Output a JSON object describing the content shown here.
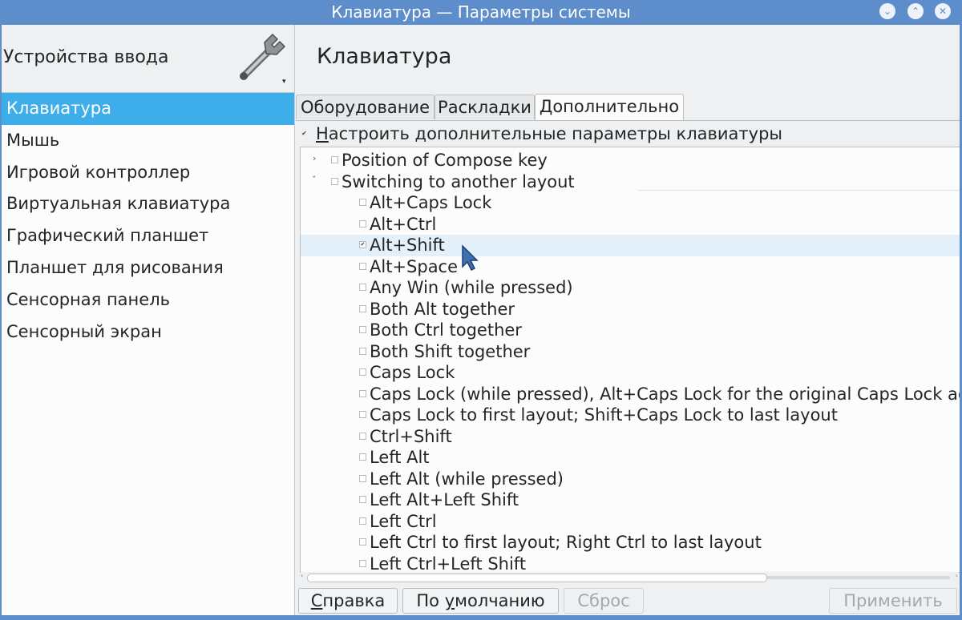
{
  "window": {
    "title": "Клавиатура — Параметры системы",
    "buttons": [
      {
        "name": "minimize",
        "glyph": "⌄"
      },
      {
        "name": "maximize",
        "glyph": "⌃"
      },
      {
        "name": "close",
        "glyph": "✕"
      }
    ]
  },
  "sidebar": {
    "header": "Устройства ввода",
    "icon": "wrench-icon",
    "items": [
      {
        "label": "Клавиатура",
        "selected": true
      },
      {
        "label": "Мышь",
        "selected": false
      },
      {
        "label": "Игровой контроллер",
        "selected": false
      },
      {
        "label": "Виртуальная клавиатура",
        "selected": false
      },
      {
        "label": "Графический планшет",
        "selected": false
      },
      {
        "label": "Планшет для рисования",
        "selected": false
      },
      {
        "label": "Сенсорная панель",
        "selected": false
      },
      {
        "label": "Сенсорный экран",
        "selected": false
      }
    ]
  },
  "main": {
    "title": "Клавиатура",
    "tabs": [
      {
        "label": "Оборудование",
        "active": false
      },
      {
        "label": "Раскладки",
        "active": false
      },
      {
        "label": "Дополнительно",
        "active": true
      }
    ],
    "configure_option": {
      "label": "Настроить дополнительные параметры клавиатуры",
      "checked": true
    },
    "tree": {
      "groups": [
        {
          "label": "Position of Compose key",
          "expanded": false
        },
        {
          "label": "Switching to another layout",
          "expanded": true
        }
      ],
      "options": [
        {
          "label": "Alt+Caps Lock",
          "checked": false
        },
        {
          "label": "Alt+Ctrl",
          "checked": false
        },
        {
          "label": "Alt+Shift",
          "checked": true,
          "highlighted": true
        },
        {
          "label": "Alt+Space",
          "checked": false
        },
        {
          "label": "Any Win (while pressed)",
          "checked": false
        },
        {
          "label": "Both Alt together",
          "checked": false
        },
        {
          "label": "Both Ctrl together",
          "checked": false
        },
        {
          "label": "Both Shift together",
          "checked": false
        },
        {
          "label": "Caps Lock",
          "checked": false
        },
        {
          "label": "Caps Lock (while pressed), Alt+Caps Lock for the original Caps Lock ac",
          "checked": false
        },
        {
          "label": "Caps Lock to first layout; Shift+Caps Lock to last layout",
          "checked": false
        },
        {
          "label": "Ctrl+Shift",
          "checked": false
        },
        {
          "label": "Left Alt",
          "checked": false
        },
        {
          "label": "Left Alt (while pressed)",
          "checked": false
        },
        {
          "label": "Left Alt+Left Shift",
          "checked": false
        },
        {
          "label": "Left Ctrl",
          "checked": false
        },
        {
          "label": "Left Ctrl to first layout; Right Ctrl to last layout",
          "checked": false
        },
        {
          "label": "Left Ctrl+Left Shift",
          "checked": false
        }
      ]
    }
  },
  "footer": {
    "help": {
      "mnemonic": "С",
      "rest": "правка"
    },
    "defaults": {
      "pre": "По ",
      "mnemonic": "у",
      "rest": "молчанию"
    },
    "reset": "Сброс",
    "apply": "Применить"
  },
  "colors": {
    "titlebar": "#5d8ecb",
    "selection": "#3daee9",
    "row_highlight": "#e3f0fa",
    "background": "#eff0f1"
  }
}
